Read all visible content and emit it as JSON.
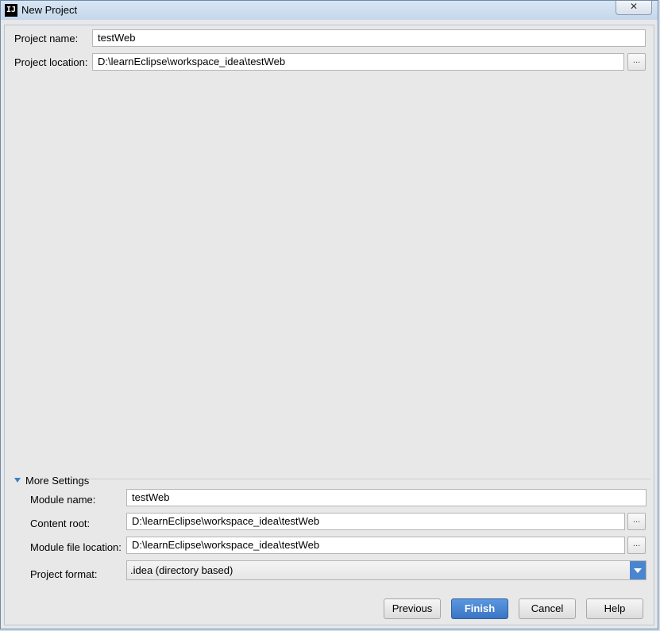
{
  "window": {
    "title": "New Project",
    "icon_text": "IJ",
    "close_glyph": "✕"
  },
  "project": {
    "name_label": "Project name:",
    "name_value": "testWeb",
    "location_label": "Project location:",
    "location_value": "D:\\learnEclipse\\workspace_idea\\testWeb"
  },
  "more_settings": {
    "header": "More Settings",
    "module_name_label": "Module name:",
    "module_name_value": "testWeb",
    "content_root_label": "Content root:",
    "content_root_value": "D:\\learnEclipse\\workspace_idea\\testWeb",
    "module_file_label": "Module file location:",
    "module_file_value": "D:\\learnEclipse\\workspace_idea\\testWeb",
    "format_label": "Project format:",
    "format_value": ".idea (directory based)"
  },
  "browse_glyph": "...",
  "buttons": {
    "previous": "Previous",
    "finish": "Finish",
    "cancel": "Cancel",
    "help": "Help"
  },
  "colors": {
    "accent": "#3a74c4",
    "dropdown": "#4a86d0"
  }
}
